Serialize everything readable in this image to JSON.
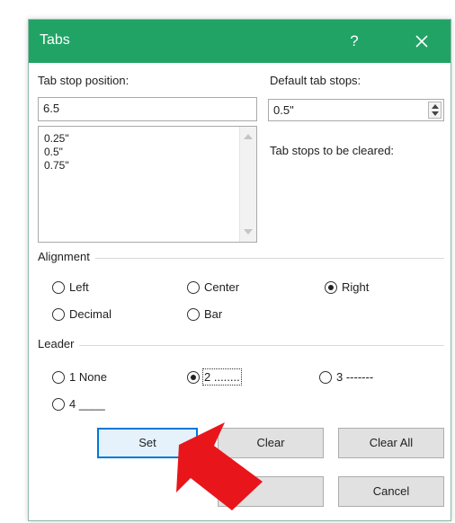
{
  "dialog": {
    "title": "Tabs",
    "help_glyph": "?",
    "close_glyph": "✕"
  },
  "tab_stop_position": {
    "label": "Tab stop position:",
    "value": "6.5",
    "list": [
      "0.25\"",
      "0.5\"",
      "0.75\""
    ]
  },
  "default_tab_stops": {
    "label": "Default tab stops:",
    "value": "0.5\""
  },
  "tab_stops_to_clear": {
    "label": "Tab stops to be cleared:"
  },
  "alignment": {
    "label": "Alignment",
    "options": [
      "Left",
      "Center",
      "Right",
      "Decimal",
      "Bar"
    ],
    "selected": "Right"
  },
  "leader": {
    "label": "Leader",
    "options": [
      "1 None",
      "2 ........",
      "3 -------",
      "4 ____"
    ],
    "selected": "2 ........"
  },
  "buttons": {
    "set": "Set",
    "clear": "Clear",
    "clear_all": "Clear All",
    "ok": "",
    "cancel": "Cancel"
  },
  "annotation": {
    "arrow_color": "#e8161b",
    "title_bar_color": "#21a366"
  }
}
